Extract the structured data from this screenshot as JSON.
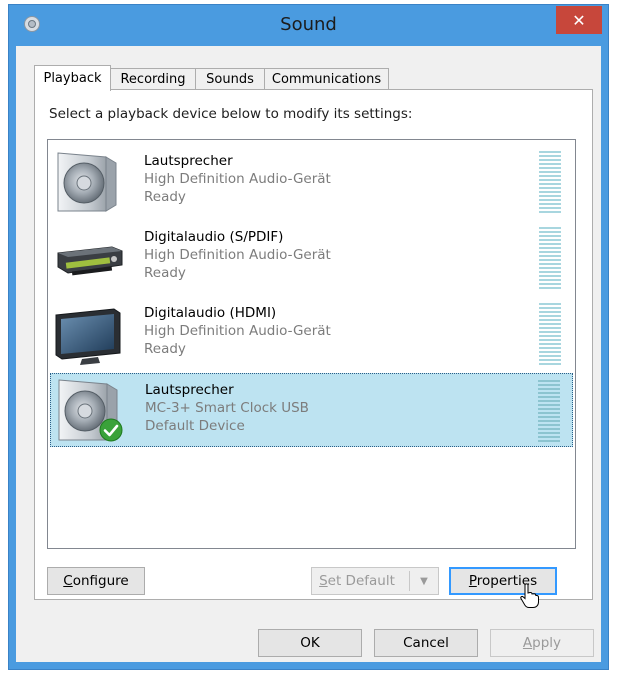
{
  "window": {
    "title": "Sound",
    "close_glyph": "✕",
    "accent": "#4a9be0"
  },
  "tabs": [
    {
      "label": "Playback",
      "active": true
    },
    {
      "label": "Recording",
      "active": false
    },
    {
      "label": "Sounds",
      "active": false
    },
    {
      "label": "Communications",
      "active": false
    }
  ],
  "instruction": "Select a playback device below to modify its settings:",
  "devices": [
    {
      "name": "Lautsprecher",
      "description": "High Definition Audio-Gerät",
      "status": "Ready",
      "icon": "speaker-icon",
      "selected": false
    },
    {
      "name": "Digitalaudio (S/PDIF)",
      "description": "High Definition Audio-Gerät",
      "status": "Ready",
      "icon": "digital-audio-device-icon",
      "selected": false
    },
    {
      "name": "Digitalaudio (HDMI)",
      "description": "High Definition Audio-Gerät",
      "status": "Ready",
      "icon": "monitor-icon",
      "selected": false
    },
    {
      "name": "Lautsprecher",
      "description": "MC-3+ Smart Clock USB",
      "status": "Default Device",
      "icon": "speaker-icon",
      "selected": true,
      "default": true
    }
  ],
  "buttons": {
    "configure": {
      "mnemonic": "C",
      "rest": "onfigure"
    },
    "set_default": {
      "mnemonic": "S",
      "rest": "et Default",
      "arrow": "▼"
    },
    "properties": {
      "mnemonic": "P",
      "rest": "roperties"
    },
    "ok": "OK",
    "cancel": "Cancel",
    "apply": {
      "mnemonic": "A",
      "rest": "pply"
    }
  }
}
